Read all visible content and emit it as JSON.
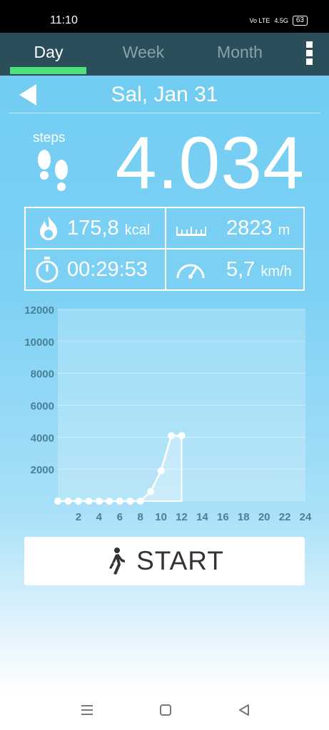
{
  "status_bar": {
    "time": "11:10",
    "signal_labels": [
      "Vo LTE",
      "4.5G"
    ],
    "battery": "63"
  },
  "tabs": [
    {
      "label": "Day",
      "active": true
    },
    {
      "label": "Week",
      "active": false
    },
    {
      "label": "Month",
      "active": false
    }
  ],
  "header": {
    "date": "Sal, Jan 31"
  },
  "summary": {
    "steps_label": "steps",
    "steps_value": "4.034"
  },
  "stats": {
    "calories": {
      "value": "175,8",
      "unit": "kcal",
      "icon": "flame-icon"
    },
    "distance": {
      "value": "2823",
      "unit": "m",
      "icon": "ruler-icon"
    },
    "duration": {
      "value": "00:29:53",
      "icon": "stopwatch-icon"
    },
    "speed": {
      "value": "5,7",
      "unit": "km/h",
      "icon": "speedometer-icon"
    }
  },
  "chart_data": {
    "type": "area",
    "x": [
      0,
      1,
      2,
      3,
      4,
      5,
      6,
      7,
      8,
      9,
      10,
      11,
      12
    ],
    "y": [
      0,
      0,
      0,
      0,
      0,
      0,
      0,
      0,
      0,
      600,
      1900,
      4100,
      4100
    ],
    "xticks": [
      "2",
      "4",
      "6",
      "8",
      "10",
      "12",
      "14",
      "16",
      "18",
      "20",
      "22",
      "24"
    ],
    "yticks": [
      "2000",
      "4000",
      "6000",
      "8000",
      "10000",
      "12000"
    ],
    "xlim": [
      0,
      24
    ],
    "ylim": [
      0,
      12000
    ],
    "grid": true
  },
  "start_button": {
    "label": "START",
    "icon": "walking-person-icon"
  },
  "nav": [
    "menu-icon",
    "home-icon",
    "back-icon"
  ],
  "colors": {
    "tabbar": "#2a4f5a",
    "indicator": "#4ee07a",
    "background": "#6ecbf2"
  }
}
